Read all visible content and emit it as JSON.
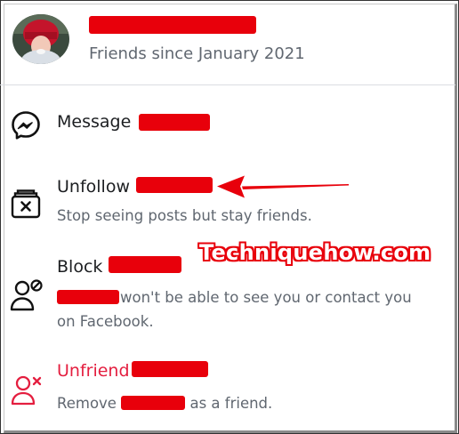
{
  "header": {
    "subtitle": "Friends since January 2021"
  },
  "menu": {
    "message": {
      "label": "Message",
      "icon": "messenger-icon"
    },
    "unfollow": {
      "label": "Unfollow",
      "desc": "Stop seeing posts but stay friends.",
      "icon": "unfollow-box-icon"
    },
    "block": {
      "label": "Block",
      "desc": " won't be able to see you or contact you on Facebook.",
      "icon": "block-person-icon"
    },
    "unfriend": {
      "label": "Unfriend",
      "desc_prefix": "Remove ",
      "desc_suffix": " as a friend.",
      "icon": "unfriend-person-icon"
    }
  },
  "watermark": "Techniquehow.com",
  "colors": {
    "redaction": "#e8000b",
    "unfriend": "#e41e3f",
    "secondary_text": "#606770"
  }
}
